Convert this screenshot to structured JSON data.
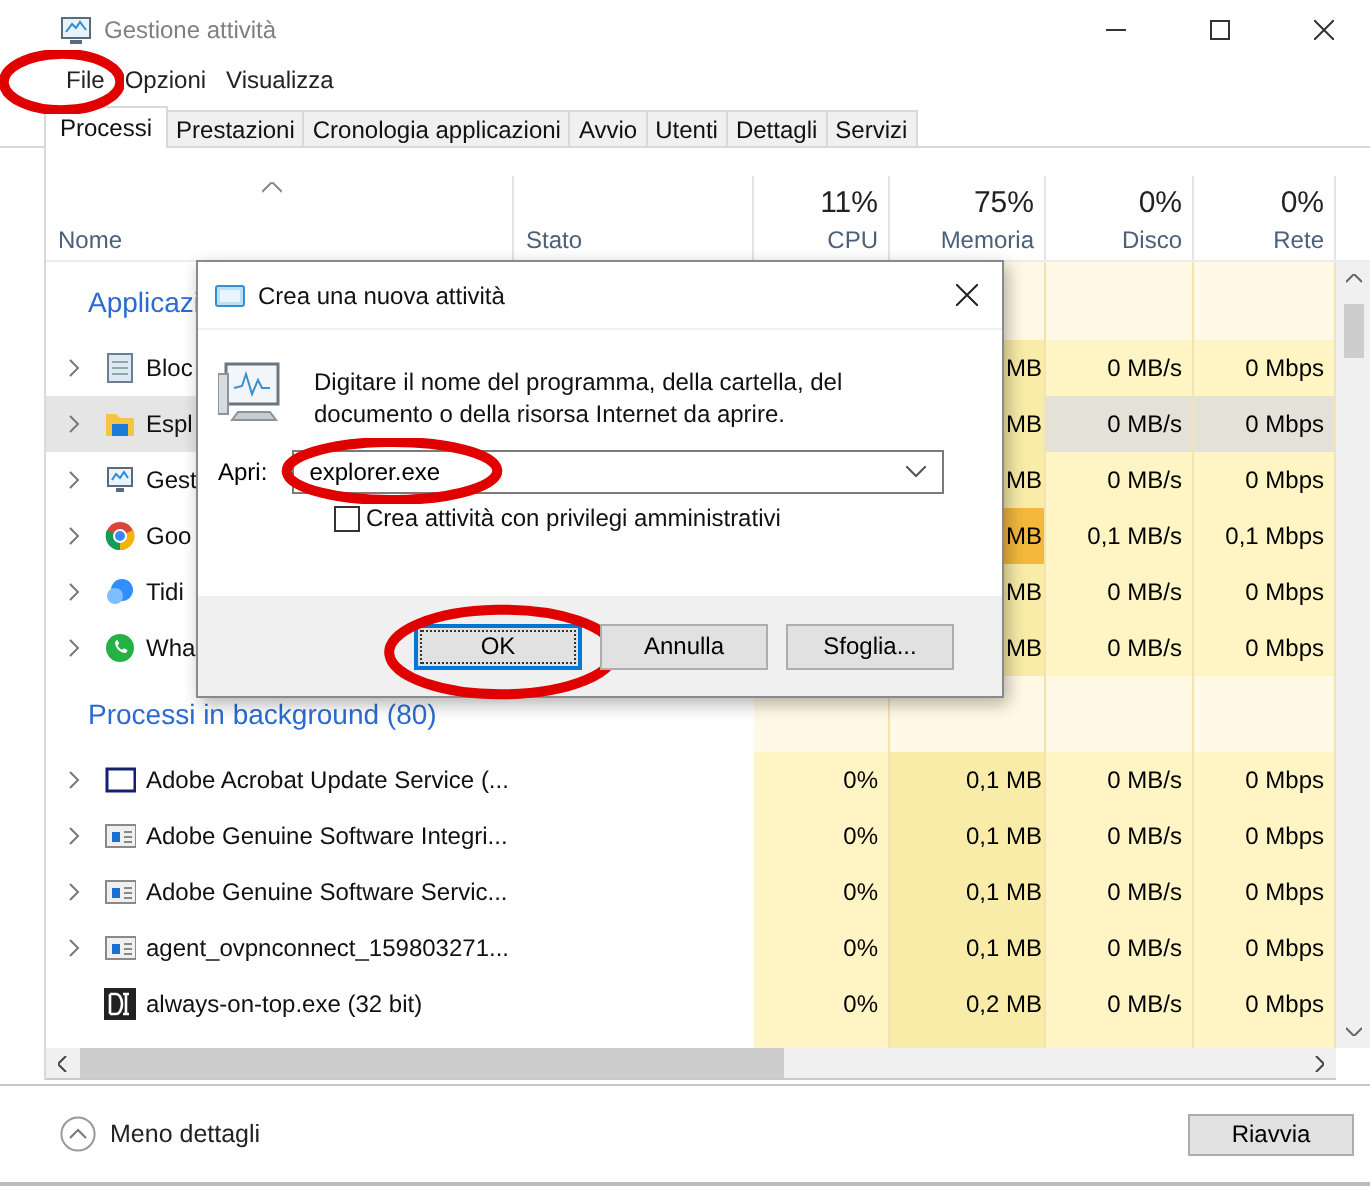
{
  "window": {
    "title": "Gestione attività"
  },
  "menu": [
    {
      "label": "File",
      "highlighted": true
    },
    {
      "label": "Opzioni",
      "highlighted": false
    },
    {
      "label": "Visualizza",
      "highlighted": false
    }
  ],
  "tabs": [
    {
      "label": "Processi",
      "selected": true
    },
    {
      "label": "Prestazioni",
      "selected": false
    },
    {
      "label": "Cronologia applicazioni",
      "selected": false
    },
    {
      "label": "Avvio",
      "selected": false
    },
    {
      "label": "Utenti",
      "selected": false
    },
    {
      "label": "Dettagli",
      "selected": false
    },
    {
      "label": "Servizi",
      "selected": false
    }
  ],
  "columns": [
    {
      "label": "Nome",
      "sorted": true
    },
    {
      "label": "Stato",
      "sorted": false
    },
    {
      "label": "CPU",
      "total": "11%"
    },
    {
      "label": "Memoria",
      "total": "75%"
    },
    {
      "label": "Disco",
      "total": "0%"
    },
    {
      "label": "Rete",
      "total": "0%"
    }
  ],
  "groups": [
    {
      "title": "Applicazi",
      "rows": [
        {
          "kind": "notepad",
          "name": "Bloc",
          "memory": "MB",
          "disk": "0 MB/s",
          "network": "0 Mbps",
          "selected": false,
          "expandable": true,
          "memory_high": false
        },
        {
          "kind": "folder",
          "name": "Espl",
          "memory": "MB",
          "disk": "0 MB/s",
          "network": "0 Mbps",
          "selected": true,
          "expandable": true,
          "memory_high": false
        },
        {
          "kind": "monitor",
          "name": "Gest",
          "memory": "MB",
          "disk": "0 MB/s",
          "network": "0 Mbps",
          "selected": false,
          "expandable": true,
          "memory_high": false
        },
        {
          "kind": "chrome",
          "name": "Goo",
          "memory": "MB",
          "disk": "0,1 MB/s",
          "network": "0,1 Mbps",
          "selected": false,
          "expandable": true,
          "memory_high": true
        },
        {
          "kind": "chat",
          "name": "Tidi",
          "memory": "MB",
          "disk": "0 MB/s",
          "network": "0 Mbps",
          "selected": false,
          "expandable": true,
          "memory_high": false
        },
        {
          "kind": "phone",
          "name": "Wha",
          "memory": "MB",
          "disk": "0 MB/s",
          "network": "0 Mbps",
          "selected": false,
          "expandable": true,
          "memory_high": false
        }
      ]
    },
    {
      "title": "Processi in background (80)",
      "rows": [
        {
          "kind": "window",
          "name": "Adobe Acrobat Update Service (...",
          "cpu": "0%",
          "memory": "0,1 MB",
          "disk": "0 MB/s",
          "network": "0 Mbps",
          "selected": false,
          "expandable": true,
          "memory_high": false
        },
        {
          "kind": "service",
          "name": "Adobe Genuine Software Integri...",
          "cpu": "0%",
          "memory": "0,1 MB",
          "disk": "0 MB/s",
          "network": "0 Mbps",
          "selected": false,
          "expandable": true,
          "memory_high": false
        },
        {
          "kind": "service",
          "name": "Adobe Genuine Software Servic...",
          "cpu": "0%",
          "memory": "0,1 MB",
          "disk": "0 MB/s",
          "network": "0 Mbps",
          "selected": false,
          "expandable": true,
          "memory_high": false
        },
        {
          "kind": "service",
          "name": "agent_ovpnconnect_159803271...",
          "cpu": "0%",
          "memory": "0,1 MB",
          "disk": "0 MB/s",
          "network": "0 Mbps",
          "selected": false,
          "expandable": true,
          "memory_high": false
        },
        {
          "kind": "badge",
          "name": "always-on-top.exe (32 bit)",
          "cpu": "0%",
          "memory": "0,2 MB",
          "disk": "0 MB/s",
          "network": "0 Mbps",
          "selected": false,
          "expandable": false,
          "memory_high": false
        }
      ]
    }
  ],
  "dialog": {
    "title": "Crea una nuova attività",
    "message": "Digitare il nome del programma, della cartella, del documento o della risorsa Internet da aprire.",
    "open_label": "Apri:",
    "open_value": "explorer.exe",
    "open_highlighted": true,
    "admin_label": "Crea attività con privilegi amministrativi",
    "admin_checked": false,
    "buttons": [
      {
        "label": "OK",
        "default": true,
        "highlighted": true
      },
      {
        "label": "Annulla",
        "default": false,
        "highlighted": false
      },
      {
        "label": "Sfoglia...",
        "default": false,
        "highlighted": false
      }
    ]
  },
  "footer": {
    "details_label": "Meno dettagli",
    "restart_button": "Riavvia"
  }
}
